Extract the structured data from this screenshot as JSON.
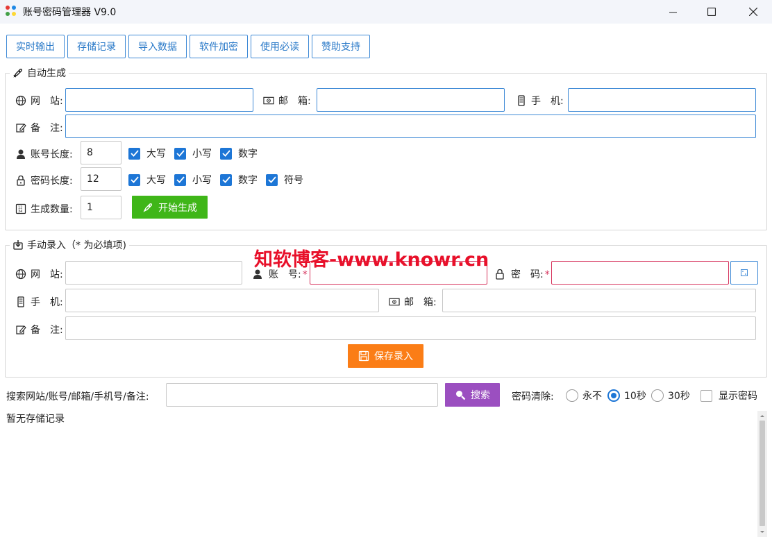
{
  "window": {
    "title": "账号密码管理器 V9.0",
    "icon_colors": [
      "#e53935",
      "#1e88e5",
      "#43a047",
      "#fdd835"
    ]
  },
  "toolbar": {
    "buttons": [
      "实时输出",
      "存储记录",
      "导入数据",
      "软件加密",
      "使用必读",
      "赞助支持"
    ]
  },
  "auto": {
    "legend": "自动生成",
    "website_label": "网　站:",
    "email_label": "邮　箱:",
    "phone_label": "手　机:",
    "note_label": "备　注:",
    "account_len_label": "账号长度:",
    "account_len_value": "8",
    "account_opts": [
      "大写",
      "小写",
      "数字"
    ],
    "password_len_label": "密码长度:",
    "password_len_value": "12",
    "password_opts": [
      "大写",
      "小写",
      "数字",
      "符号"
    ],
    "count_label": "生成数量:",
    "count_value": "1",
    "generate_button": "开始生成"
  },
  "manual": {
    "legend": "手动录入（* 为必填项)",
    "website_label": "网　站:",
    "account_label": "账　号:",
    "password_label": "密　码:",
    "required_mark": "*",
    "phone_label": "手　机:",
    "email_label": "邮　箱:",
    "note_label": "备　注:",
    "save_button": "保存录入"
  },
  "watermark": "知软博客-www.knowr.cn",
  "search": {
    "label": "搜索网站/账号/邮箱/手机号/备注:",
    "button": "搜索",
    "clear_label": "密码清除:",
    "options": [
      "永不",
      "10秒",
      "30秒"
    ],
    "selected": "10秒",
    "show_password": "显示密码"
  },
  "empty_text": "暂无存储记录",
  "colors": {
    "accent": "#1d76d6",
    "generate": "#3fb618",
    "save": "#fb7d16",
    "search": "#9b4fc0",
    "required": "#d6335c"
  }
}
